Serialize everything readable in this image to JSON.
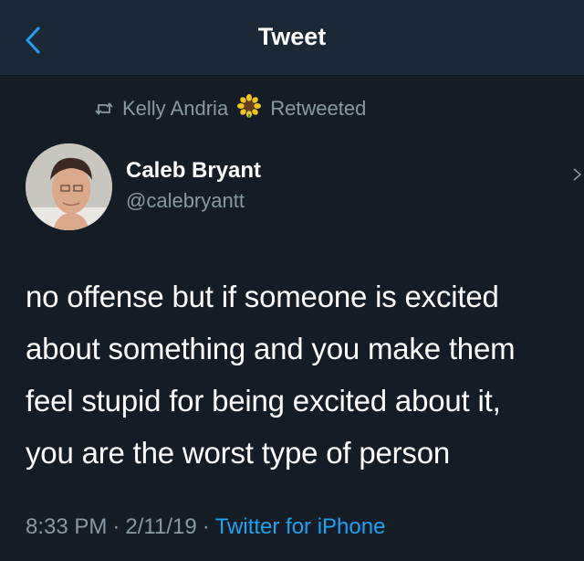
{
  "header": {
    "title": "Tweet",
    "back_icon": "chevron-left-icon",
    "accent_color": "#1da1f2",
    "background": "#1b2836"
  },
  "retweet": {
    "icon": "retweet-icon",
    "user": "Kelly Andria",
    "emoji_icon": "sunflower-icon",
    "label": "Retweeted"
  },
  "tweet": {
    "author_name": "Caleb Bryant",
    "author_handle": "@calebryantt",
    "text": "no offense but if someone is excited\nabout something and you make them\nfeel stupid for being excited about it,\nyou are the worst type of person",
    "time": "8:33 PM",
    "date": "2/11/19",
    "source": "Twitter for iPhone",
    "separator": "·"
  },
  "colors": {
    "background": "#141d26",
    "secondary_text": "#8899a6",
    "link": "#1da1f2"
  }
}
